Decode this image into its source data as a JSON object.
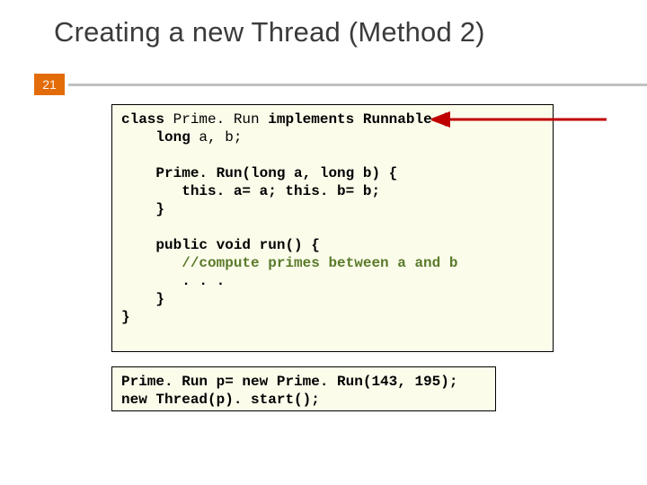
{
  "title": "Creating a new Thread (Method 2)",
  "page_number": "21",
  "code1": {
    "l1_a": "class",
    "l1_b": " Prime. Run ",
    "l1_c": "implements",
    "l1_d": " ",
    "l1_e": "Runnable",
    "l1_f": " {",
    "l2_a": "    long",
    "l2_b": " a, b;",
    "l3": "    Prime. Run(long a, long b) {",
    "l4": "       this. a= a; this. b= b;",
    "l5": "    }",
    "l6_a": "    public",
    "l6_b": " ",
    "l6_c": "void",
    "l6_d": " run() {",
    "l7": "       //compute primes between a and b",
    "l8": "       . . .",
    "l9": "    }",
    "l10": "}"
  },
  "code2": {
    "l1_a": "Prime. Run p= ",
    "l1_b": "new",
    "l1_c": " Prime. Run(143, 195);",
    "l2_a": "new",
    "l2_b": " Thread(p). start();"
  },
  "arrow_color": "#c00000"
}
